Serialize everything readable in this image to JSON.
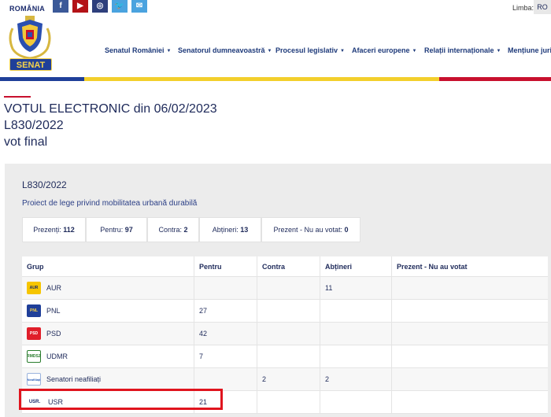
{
  "header": {
    "logo_text": "ROMÂNIA",
    "logo_badge": "SENAT",
    "social": [
      {
        "icon": "facebook-icon",
        "glyph": "f"
      },
      {
        "icon": "youtube-icon",
        "glyph": "▶"
      },
      {
        "icon": "instagram-icon",
        "glyph": "◎"
      },
      {
        "icon": "twitter-icon",
        "glyph": "🐦"
      },
      {
        "icon": "email-icon",
        "glyph": "✉"
      }
    ],
    "language_label": "Limba:",
    "language_value": "RO",
    "nav": [
      "Senatul României",
      "Senatorul dumneavoastră",
      "Procesul legislativ",
      "Afaceri europene",
      "Relații internaționale",
      "Mențiune jurid"
    ]
  },
  "title": {
    "line1": "VOTUL ELECTRONIC din 06/02/2023",
    "line2": "L830/2022",
    "line3": "vot final"
  },
  "panel": {
    "code": "L830/2022",
    "description": "Proiect de lege privind mobilitatea urbană durabilă",
    "stats": [
      {
        "label": "Prezenți:",
        "value": "112"
      },
      {
        "label": "Pentru:",
        "value": "97"
      },
      {
        "label": "Contra:",
        "value": "2"
      },
      {
        "label": "Abțineri:",
        "value": "13"
      },
      {
        "label": "Prezent - Nu au votat:",
        "value": "0"
      }
    ]
  },
  "table": {
    "headers": [
      "Grup",
      "Pentru",
      "Contra",
      "Abțineri",
      "Prezent - Nu au votat"
    ],
    "rows": [
      {
        "group": "AUR",
        "icon_label": "AUR",
        "pentru": "",
        "contra": "",
        "abtineri": "11",
        "prezent": ""
      },
      {
        "group": "PNL",
        "icon_label": "PNL",
        "pentru": "27",
        "contra": "",
        "abtineri": "",
        "prezent": ""
      },
      {
        "group": "PSD",
        "icon_label": "PSD",
        "pentru": "42",
        "contra": "",
        "abtineri": "",
        "prezent": ""
      },
      {
        "group": "UDMR",
        "icon_label": "RMDSZ",
        "pentru": "7",
        "contra": "",
        "abtineri": "",
        "prezent": ""
      },
      {
        "group": "Senatori neafiliați",
        "icon_label": "Neafiliați",
        "pentru": "",
        "contra": "2",
        "abtineri": "2",
        "prezent": ""
      },
      {
        "group": "USR",
        "icon_label": "USR.",
        "pentru": "21",
        "contra": "",
        "abtineri": "",
        "prezent": ""
      }
    ]
  },
  "colors": {
    "navy": "#1e2a5a",
    "flag_blue": "#1f3f99",
    "flag_yellow": "#f3cf2b",
    "flag_red": "#c8102e",
    "highlight": "#e0141e"
  }
}
